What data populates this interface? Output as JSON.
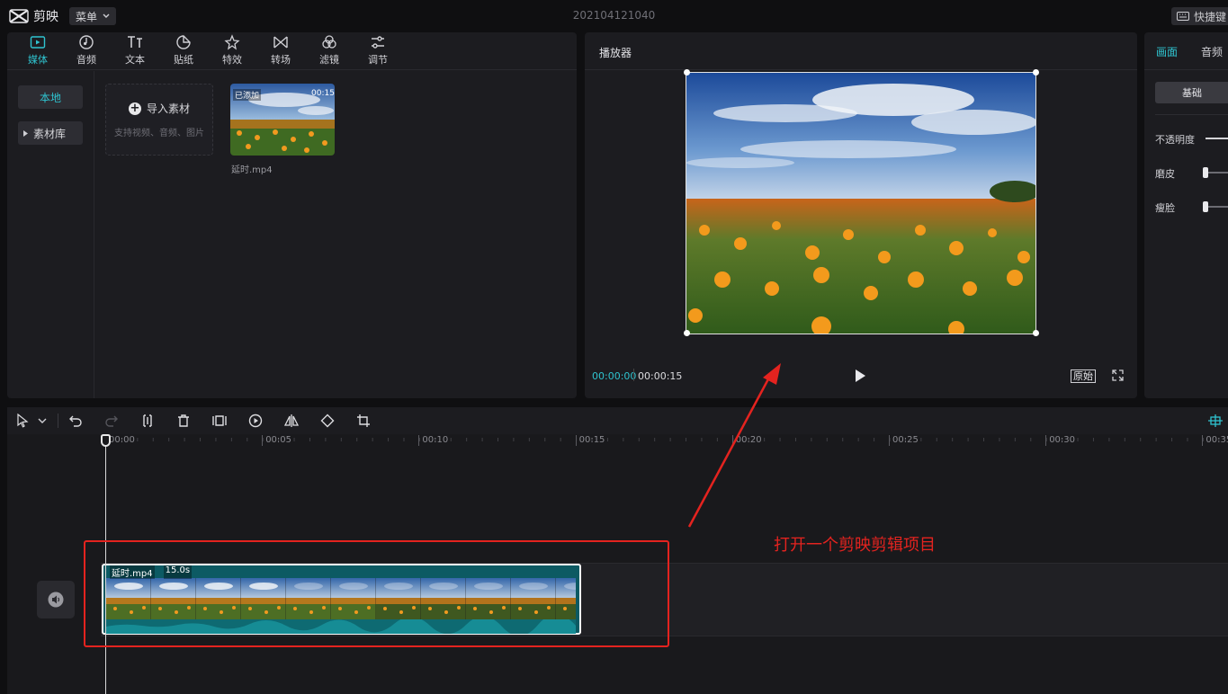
{
  "app": {
    "name": "剪映",
    "menu_label": "菜单",
    "project_title": "202104121040",
    "shortcut_label": "快捷键"
  },
  "media_tabs": [
    {
      "label": "媒体",
      "icon": "media-icon",
      "active": true
    },
    {
      "label": "音频",
      "icon": "audio-icon"
    },
    {
      "label": "文本",
      "icon": "text-icon"
    },
    {
      "label": "贴纸",
      "icon": "sticker-icon"
    },
    {
      "label": "特效",
      "icon": "effect-icon"
    },
    {
      "label": "转场",
      "icon": "transition-icon"
    },
    {
      "label": "滤镜",
      "icon": "filter-icon"
    },
    {
      "label": "调节",
      "icon": "adjust-icon"
    }
  ],
  "media_sidebar": {
    "local": "本地",
    "library": "素材库"
  },
  "import": {
    "label": "导入素材",
    "hint": "支持视频、音频、图片"
  },
  "media_clip": {
    "added": "已添加",
    "duration": "00:15",
    "name": "延时.mp4"
  },
  "player": {
    "title": "播放器",
    "current_time": "00:00:00",
    "total_time": "00:00:15",
    "original_label": "原始"
  },
  "properties": {
    "tabs": [
      "画面",
      "音频"
    ],
    "basic_label": "基础",
    "opacity_label": "不透明度",
    "smooth_label": "磨皮",
    "slim_label": "瘦脸"
  },
  "timeline": {
    "ruler": [
      "00:00",
      "00:05",
      "00:10",
      "00:15",
      "00:20",
      "00:25",
      "00:30",
      "00:35"
    ],
    "clip_name": "延时.mp4",
    "clip_duration": "15.0s"
  },
  "annotation": {
    "text": "打开一个剪映剪辑项目"
  },
  "colors": {
    "accent": "#2fc3cf",
    "annotation": "#e4231f",
    "clip": "#0c5a63"
  }
}
